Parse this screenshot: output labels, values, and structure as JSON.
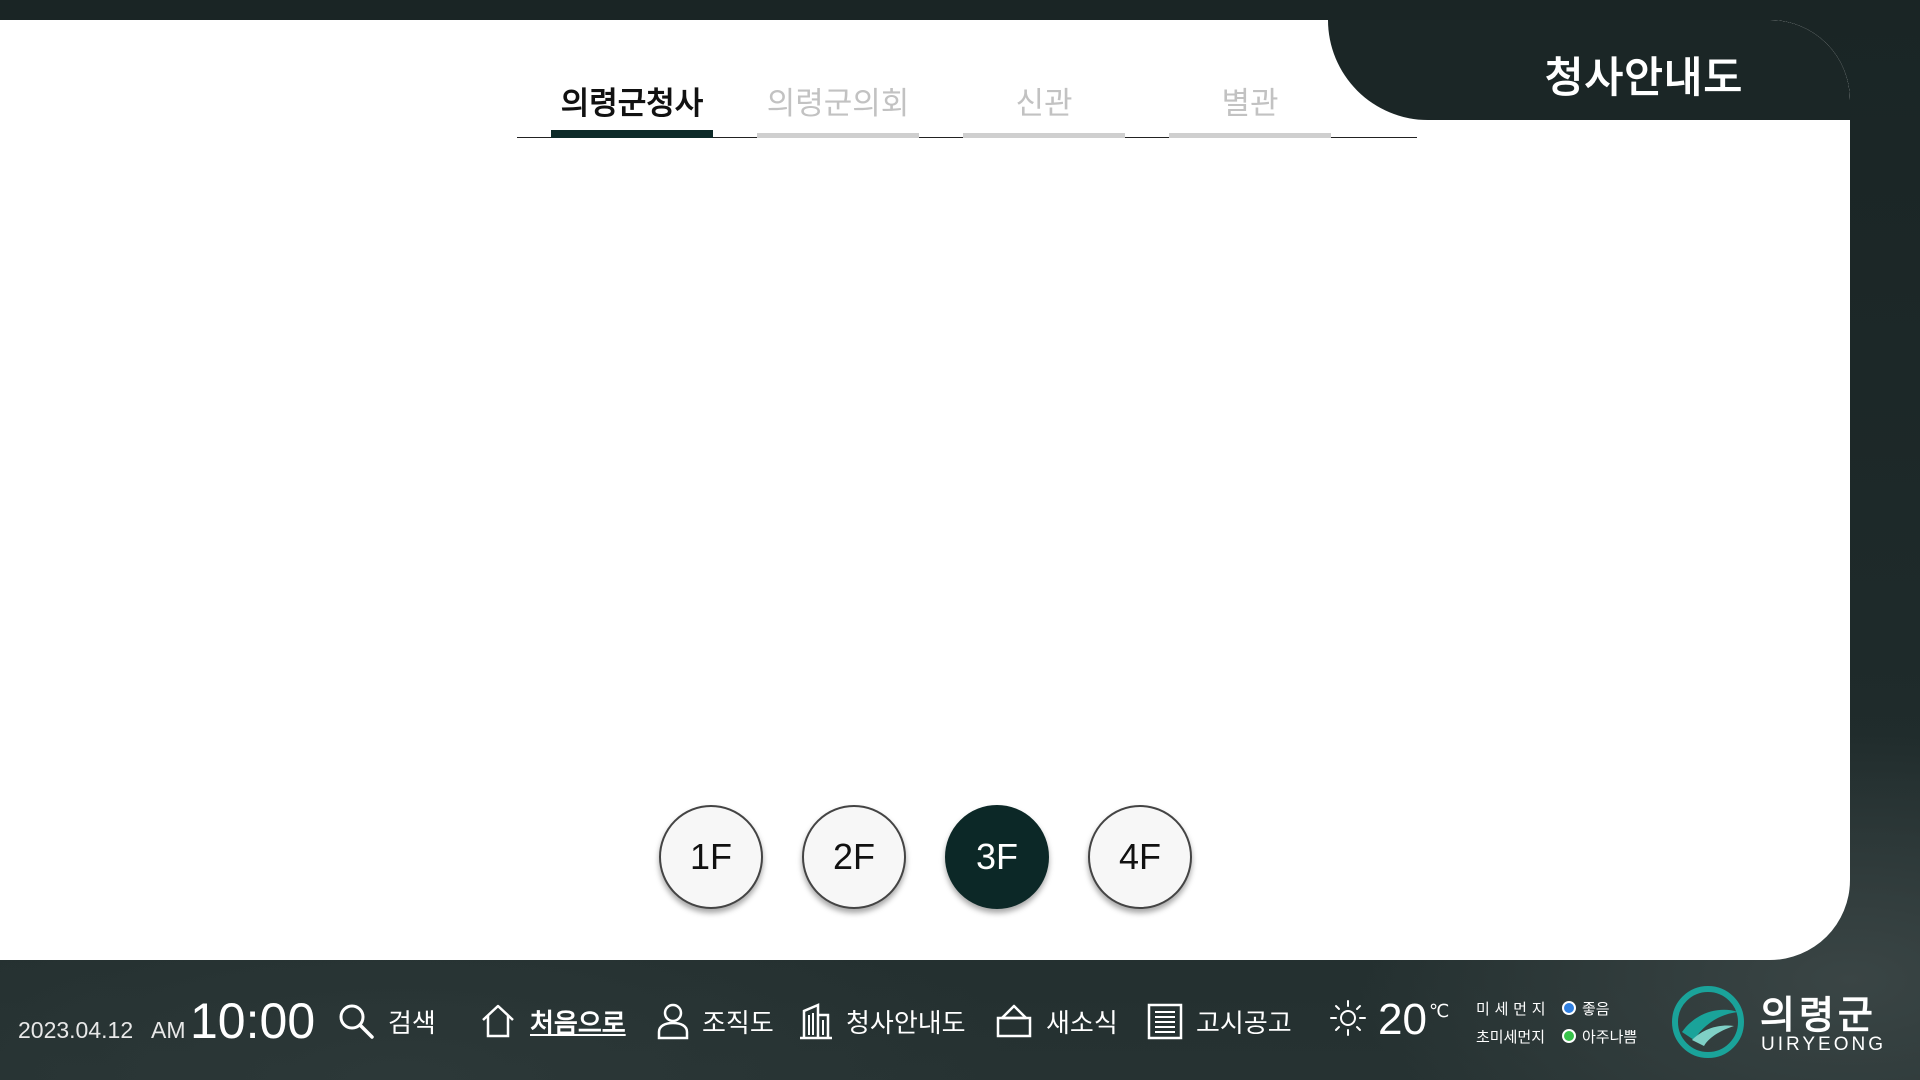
{
  "header": {
    "title": "청사안내도"
  },
  "tabs": [
    {
      "label": "의령군청사",
      "active": true
    },
    {
      "label": "의령군의회",
      "active": false
    },
    {
      "label": "신관",
      "active": false
    },
    {
      "label": "별관",
      "active": false
    }
  ],
  "floors": [
    {
      "label": "1F",
      "active": false
    },
    {
      "label": "2F",
      "active": false
    },
    {
      "label": "3F",
      "active": true
    },
    {
      "label": "4F",
      "active": false
    }
  ],
  "footer": {
    "date": "2023.04.12",
    "ampm": "AM",
    "time": "10:00",
    "nav": [
      {
        "label": "검색",
        "icon": "search-icon"
      },
      {
        "label": "처음으로",
        "icon": "home-icon",
        "current": true
      },
      {
        "label": "조직도",
        "icon": "person-icon"
      },
      {
        "label": "청사안내도",
        "icon": "building-icon"
      },
      {
        "label": "새소식",
        "icon": "bell-icon"
      },
      {
        "label": "고시공고",
        "icon": "document-icon"
      }
    ],
    "weather": {
      "icon": "sun-icon",
      "temperature": "20",
      "unit": "℃"
    },
    "dust": [
      {
        "label": "미 세 먼 지",
        "status": "좋음",
        "color": "#2f7fe0"
      },
      {
        "label": "초미세먼지",
        "status": "아주나쁨",
        "color": "#37c24a"
      }
    ],
    "logo": {
      "name": "의령군",
      "english": "UIRYEONG",
      "color": "#1aa39a"
    }
  },
  "colors": {
    "accent": "#0c2827",
    "background": "#1b2626"
  }
}
